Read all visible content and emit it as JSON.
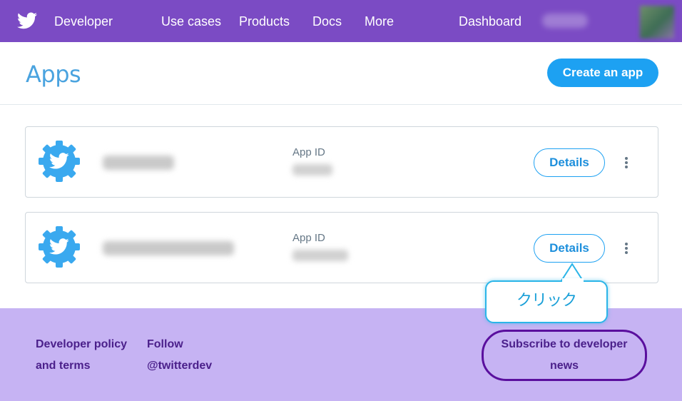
{
  "nav": {
    "brand": "Developer",
    "links": [
      "Use cases",
      "Products",
      "Docs",
      "More"
    ],
    "dashboard": "Dashboard",
    "logo_icon": "twitter-bird-icon",
    "bg_color": "#7b4bc4"
  },
  "header": {
    "title": "Apps",
    "create_label": "Create an app",
    "accent_color": "#1da1f2"
  },
  "apps": [
    {
      "id_label": "App ID",
      "details_label": "Details",
      "icon": "twitter-gear-icon"
    },
    {
      "id_label": "App ID",
      "details_label": "Details",
      "icon": "twitter-gear-icon"
    }
  ],
  "callout": {
    "text": "クリック"
  },
  "footer": {
    "policy_line1": "Developer policy",
    "policy_line2": "and terms",
    "follow_line1": "Follow",
    "follow_line2": "@twitterdev",
    "subscribe_line1": "Subscribe to developer",
    "subscribe_line2": "news",
    "bg_color": "#c6b3f3"
  }
}
